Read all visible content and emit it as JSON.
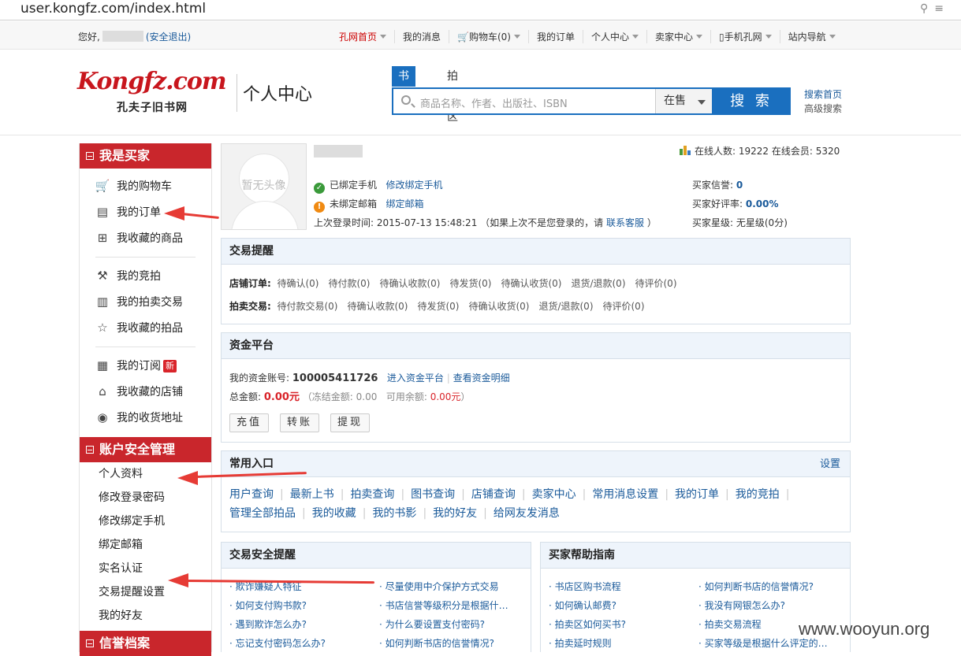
{
  "browser": {
    "url": "user.kongfz.com/index.html"
  },
  "topbar": {
    "greeting": "您好,",
    "logout": "(安全退出)",
    "nav": [
      "孔网首页",
      "我的消息",
      "购物车(0)",
      "我的订单",
      "个人中心",
      "卖家中心",
      "手机孔网",
      "站内导航"
    ]
  },
  "header": {
    "logo_text": "Kongfz.com",
    "logo_cn": "孔夫子旧书网",
    "title": "个人中心",
    "tab_active": "书店区",
    "tab_inactive": "拍卖区",
    "search_placeholder": "商品名称、作者、出版社、ISBN",
    "search_select": "在售",
    "search_button": "搜 索",
    "link_home": "搜索首页",
    "link_advanced": "高级搜索"
  },
  "sidebar": {
    "buyer_title": "我是买家",
    "buyer_items": [
      "我的购物车",
      "我的订单",
      "我收藏的商品",
      "我的竞拍",
      "我的拍卖交易",
      "我收藏的拍品",
      "我的订阅",
      "我收藏的店铺",
      "我的收货地址"
    ],
    "new_badge": "新",
    "security_title": "账户安全管理",
    "security_items": [
      "个人资料",
      "修改登录密码",
      "修改绑定手机",
      "绑定邮箱",
      "实名认证",
      "交易提醒设置",
      "我的好友"
    ],
    "credit_title": "信誉档案"
  },
  "profile": {
    "avatar_text": "暂无头像",
    "phone_bound": "已绑定手机",
    "phone_modify": "修改绑定手机",
    "email_unbound": "未绑定邮箱",
    "email_bind": "绑定邮箱",
    "last_login_label": "上次登录时间:",
    "last_login_time": "2015-07-13 15:48:21",
    "last_login_hint": "（如果上次不是您登录的，请",
    "contact": "联系客服",
    "hint_close": "）",
    "online": "在线人数: 19222 在线会员: 5320",
    "credit_label": "买家信誉:",
    "credit_value": "0",
    "rate_label": "买家好评率:",
    "rate_value": "0.00%",
    "star_label": "买家星级:",
    "star_value": "无星级(0分)"
  },
  "trade": {
    "title": "交易提醒",
    "shop_label": "店铺订单:",
    "shop_items": [
      "待确认(0)",
      "待付款(0)",
      "待确认收款(0)",
      "待发货(0)",
      "待确认收货(0)",
      "退货/退款(0)",
      "待评价(0)"
    ],
    "auction_label": "拍卖交易:",
    "auction_items": [
      "待付款交易(0)",
      "待确认收款(0)",
      "待发货(0)",
      "待确认收货(0)",
      "退货/退款(0)",
      "待评价(0)"
    ]
  },
  "funds": {
    "title": "资金平台",
    "account_label": "我的资金账号:",
    "account_no": "100005411726",
    "enter": "进入资金平台",
    "detail": "查看资金明细",
    "total_label": "总金额:",
    "total": "0.00元",
    "frozen": "（冻结金额: 0.00",
    "avail_label": "可用余额:",
    "avail": "0.00元",
    "avail_close": "）",
    "buttons": [
      "充值",
      "转账",
      "提现"
    ]
  },
  "entries": {
    "title": "常用入口",
    "settings": "设置",
    "row1": [
      "用户查询",
      "最新上书",
      "拍卖查询",
      "图书查询",
      "店铺查询",
      "卖家中心",
      "常用消息设置",
      "我的订单",
      "我的竞拍"
    ],
    "row2": [
      "管理全部拍品",
      "我的收藏",
      "我的书影",
      "我的好友",
      "给网友发消息"
    ]
  },
  "safety": {
    "title": "交易安全提醒",
    "col1": [
      "欺诈嫌疑人特征",
      "如何支付购书款?",
      "遇到欺诈怎么办?",
      "忘记支付密码怎么办?"
    ],
    "col2": [
      "尽量使用中介保护方式交易",
      "书店信誉等级积分是根据什…",
      "为什么要设置支付密码?",
      "如何判断书店的信誉情况?"
    ]
  },
  "guide": {
    "title": "买家帮助指南",
    "col1": [
      "书店区购书流程",
      "如何确认邮费?",
      "拍卖区如何买书?",
      "拍卖延时规则"
    ],
    "col2": [
      "如何判断书店的信誉情况?",
      "我没有网银怎么办?",
      "拍卖交易流程",
      "买家等级是根据什么评定的…"
    ]
  },
  "watermark": "www.wooyun.org"
}
